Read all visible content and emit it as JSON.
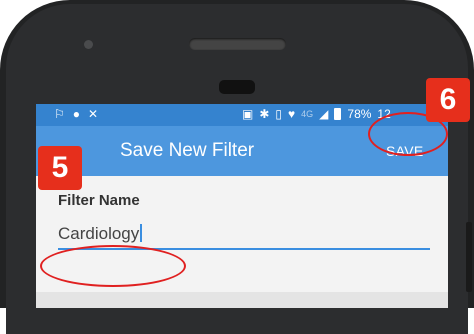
{
  "status_bar": {
    "icons_left": [
      "notification-icon",
      "android-icon",
      "missed-call-icon"
    ],
    "icons_right": [
      "cast-icon",
      "bluetooth-icon",
      "vibrate-icon",
      "wifi-icon"
    ],
    "network_label": "4G",
    "battery_percent": "78%",
    "clock": "12"
  },
  "app_bar": {
    "title": "Save New Filter",
    "save_label": "SAVE"
  },
  "form": {
    "label": "Filter Name",
    "value": "Cardiology"
  },
  "annotations": {
    "step_5": "5",
    "step_6": "6",
    "highlight_color": "#e02020",
    "badge_color": "#e62f1c"
  },
  "colors": {
    "app_bar": "#4d97de",
    "status_bar": "#3583cf",
    "input_underline": "#3a8ee0"
  }
}
